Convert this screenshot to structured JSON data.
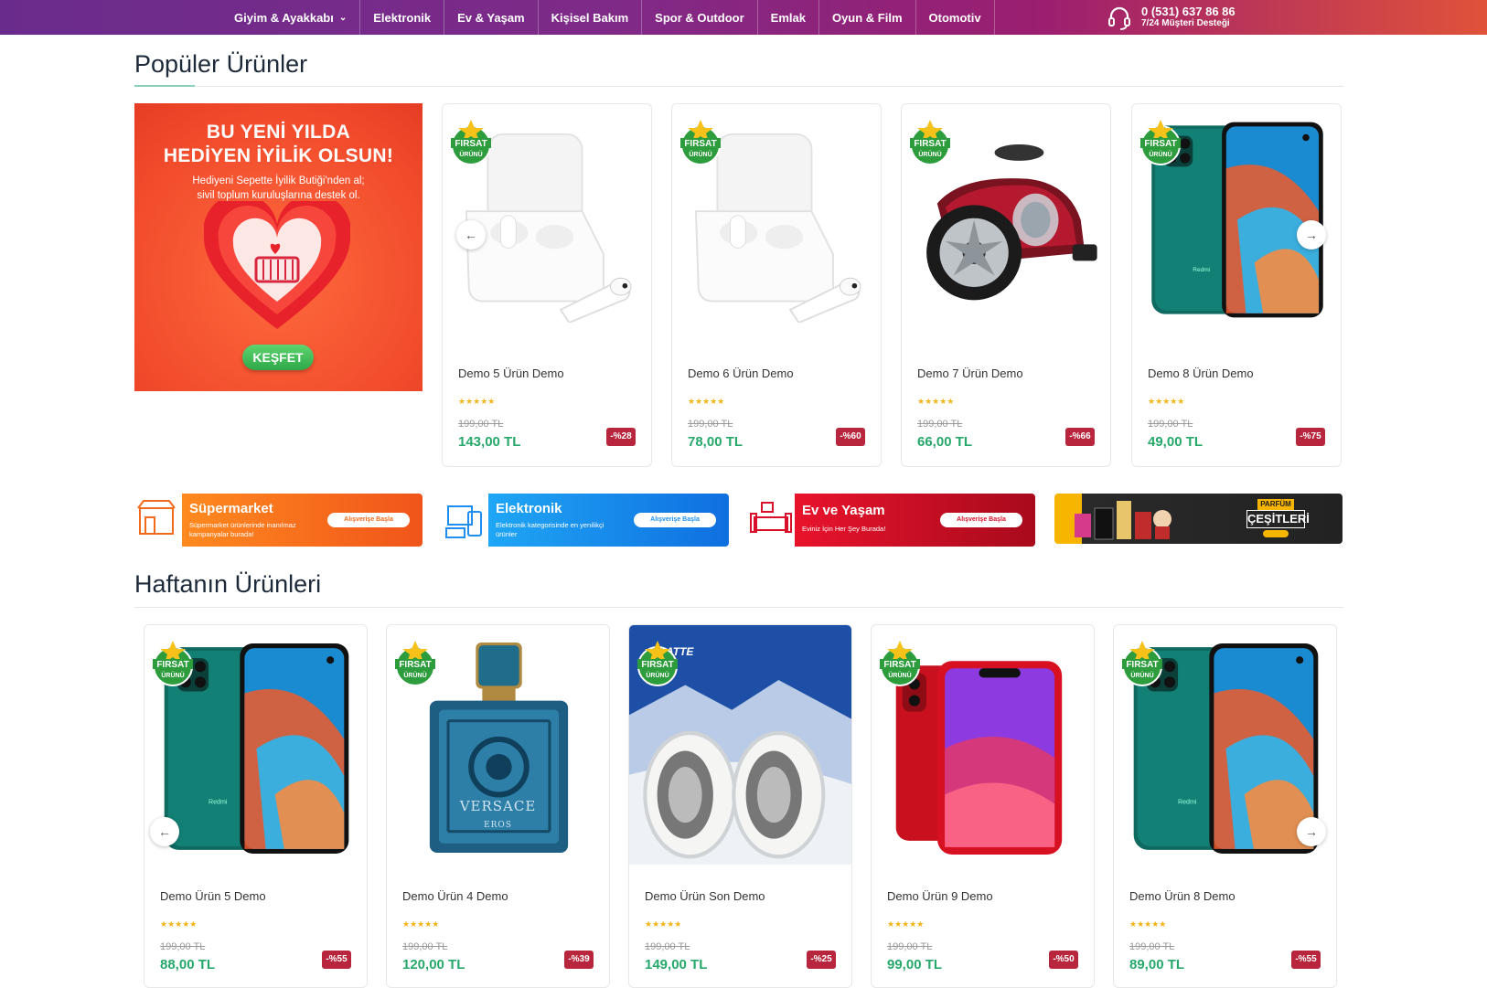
{
  "nav": {
    "items": [
      {
        "label": "Giyim & Ayakkabı",
        "has_dropdown": true
      },
      {
        "label": "Elektronik"
      },
      {
        "label": "Ev & Yaşam"
      },
      {
        "label": "Kişisel Bakım"
      },
      {
        "label": "Spor & Outdoor"
      },
      {
        "label": "Emlak"
      },
      {
        "label": "Oyun & Film"
      },
      {
        "label": "Otomotiv"
      }
    ],
    "support_phone": "0 (531) 637 86 86",
    "support_note": "7/24 Müşteri Desteği",
    "support_icon": "headset-icon"
  },
  "popular": {
    "title": "Popüler Ürünler",
    "promo": {
      "headline_1": "BU YENİ YILDA",
      "headline_2": "HEDİYEN İYİLİK OLSUN!",
      "text_1": "Hediyeni Sepette İyilik Butiği'nden al;",
      "text_2": "sivil toplum kuruluşlarına destek ol.",
      "button": "KEŞFET"
    },
    "products": [
      {
        "name": "Demo 5 Ürün Demo",
        "old_price": "199,00 TL",
        "price": "143,00 TL",
        "discount": "-%28",
        "image": "earbuds"
      },
      {
        "name": "Demo 6 Ürün Demo",
        "old_price": "199,00 TL",
        "price": "78,00 TL",
        "discount": "-%60",
        "image": "earbuds"
      },
      {
        "name": "Demo 7 Ürün Demo",
        "old_price": "199,00 TL",
        "price": "66,00 TL",
        "discount": "-%66",
        "image": "vacuum"
      },
      {
        "name": "Demo 8 Ürün Demo",
        "old_price": "199,00 TL",
        "price": "49,00 TL",
        "discount": "-%75",
        "image": "phone"
      }
    ]
  },
  "badge": {
    "line1": "FIRSAT",
    "line2": "ÜRÜNÜ"
  },
  "stars": "★★★★★",
  "banners": [
    {
      "title": "Süpermarket",
      "sub": "Süpermarket ürünlerinde inanılmaz kampanyalar burada!",
      "button": "Alışverişe Başla",
      "color": "#f26a1b"
    },
    {
      "title": "Elektronik",
      "sub": "Elektronik kategorisinde en yenilikçi ürünler",
      "button": "Alışverişe Başla",
      "color": "#1e8ff0"
    },
    {
      "title": "Ev ve Yaşam",
      "sub": "Eviniz İçin Her Şey Burada!",
      "button": "Alışverişe Başla",
      "color": "#d8102a"
    },
    {
      "title": "PARFÜM",
      "sub": "ÇEŞİTLERİ",
      "button": "",
      "color": "#222222"
    }
  ],
  "weekly": {
    "title": "Haftanın Ürünleri",
    "products": [
      {
        "name": "Demo Ürün 5 Demo",
        "old_price": "199,00 TL",
        "price": "88,00 TL",
        "discount": "-%55",
        "image": "phone"
      },
      {
        "name": "Demo Ürün 4 Demo",
        "old_price": "199,00 TL",
        "price": "120,00 TL",
        "discount": "-%39",
        "image": "perfume"
      },
      {
        "name": "Demo Ürün Son Demo",
        "old_price": "199,00 TL",
        "price": "149,00 TL",
        "discount": "-%25",
        "image": "snowsock"
      },
      {
        "name": "Demo Ürün 9 Demo",
        "old_price": "199,00 TL",
        "price": "99,00 TL",
        "discount": "-%50",
        "image": "iphone"
      },
      {
        "name": "Demo Ürün 8 Demo",
        "old_price": "199,00 TL",
        "price": "89,00 TL",
        "discount": "-%55",
        "image": "phone"
      }
    ]
  },
  "product_images": {
    "perfume_brand": "VERSACE",
    "perfume_name": "EROS",
    "snowsock_brand": "ATTE"
  }
}
